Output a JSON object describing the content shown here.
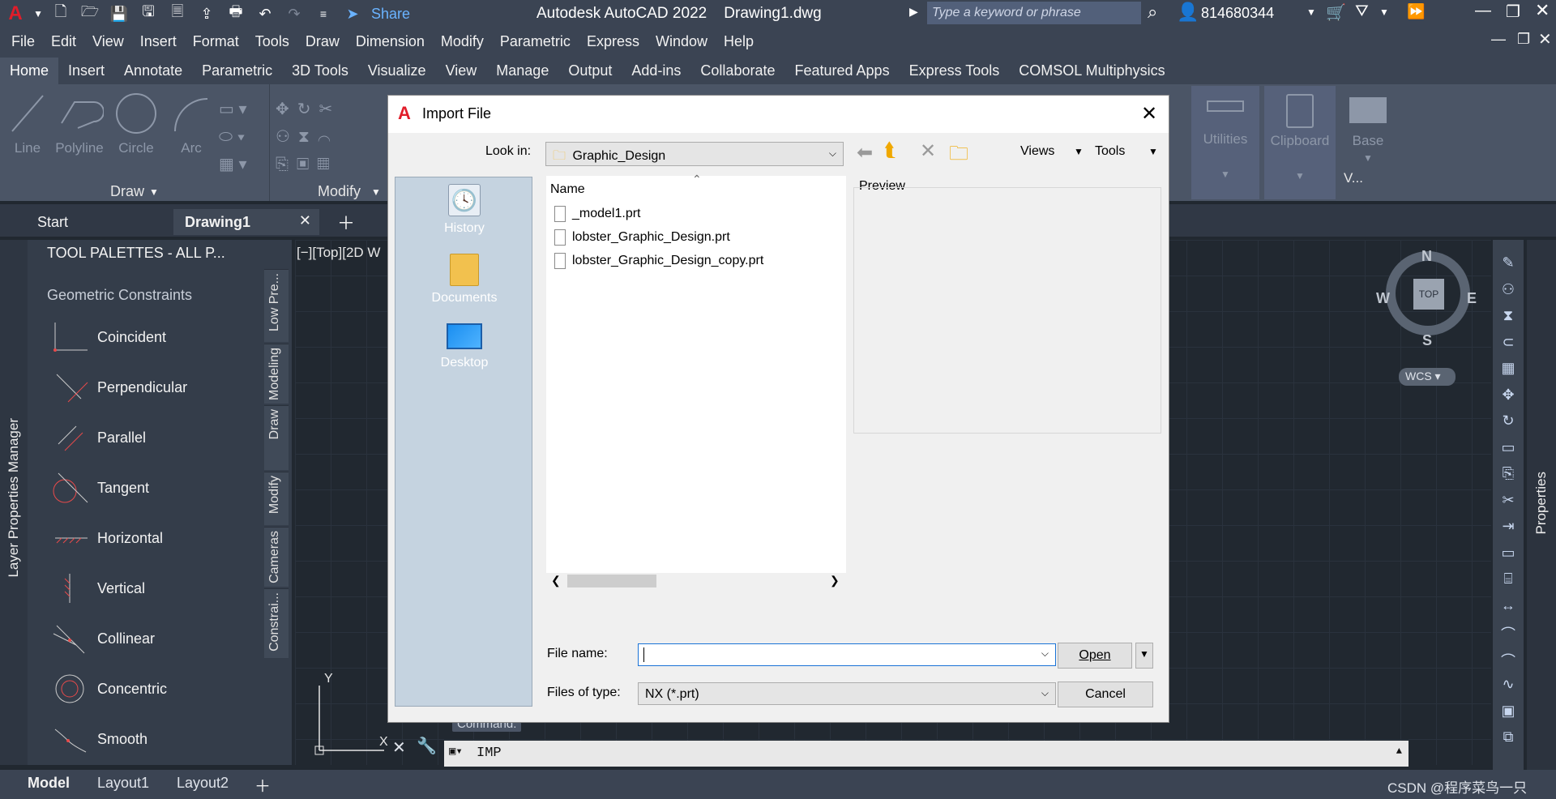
{
  "titlebar": {
    "title": "Autodesk AutoCAD 2022    Drawing1.dwg",
    "share_label": "Share",
    "search_placeholder": "Type a keyword or phrase",
    "user": "814680344"
  },
  "menu": [
    "File",
    "Edit",
    "View",
    "Insert",
    "Format",
    "Tools",
    "Draw",
    "Dimension",
    "Modify",
    "Parametric",
    "Express",
    "Window",
    "Help"
  ],
  "ribbon_tabs": [
    "Home",
    "Insert",
    "Annotate",
    "Parametric",
    "3D Tools",
    "Visualize",
    "View",
    "Manage",
    "Output",
    "Add-ins",
    "Collaborate",
    "Featured Apps",
    "Express Tools",
    "COMSOL Multiphysics"
  ],
  "ribbon": {
    "draw_tools": [
      "Line",
      "Polyline",
      "Circle",
      "Arc"
    ],
    "draw_panel": "Draw",
    "modify_panel": "Modify",
    "utilities": "Utilities",
    "clipboard": "Clipboard",
    "base": "Base",
    "view_short": "V..."
  },
  "doc_tabs": {
    "start": "Start",
    "drawing": "Drawing1"
  },
  "palette": {
    "title": "TOOL PALETTES - ALL P...",
    "side_label": "Layer Properties Manager",
    "section": "Geometric Constraints",
    "tabs": [
      "Low Pre...",
      "Modeling",
      "Draw",
      "Modify",
      "Cameras",
      "Constrai..."
    ],
    "items": [
      "Coincident",
      "Perpendicular",
      "Parallel",
      "Tangent",
      "Horizontal",
      "Vertical",
      "Collinear",
      "Concentric",
      "Smooth"
    ]
  },
  "viewport": {
    "label": "[−][Top][2D W",
    "compass": {
      "n": "N",
      "s": "S",
      "e": "E",
      "w": "W",
      "top": "TOP"
    },
    "wcs": "WCS",
    "properties_label": "Properties"
  },
  "command": {
    "tooltip": "Command:",
    "text": "IMP"
  },
  "status": {
    "tabs": [
      "Model",
      "Layout1",
      "Layout2"
    ],
    "watermark": "CSDN @程序菜鸟一只"
  },
  "dialog": {
    "title": "Import File",
    "look_in_label": "Look in:",
    "look_in_value": "Graphic_Design",
    "views": "Views",
    "tools": "Tools",
    "places": [
      "History",
      "Documents",
      "Desktop"
    ],
    "list_header": "Name",
    "files": [
      "_model1.prt",
      "lobster_Graphic_Design.prt",
      "lobster_Graphic_Design_copy.prt"
    ],
    "preview_label": "Preview",
    "file_name_label": "File name:",
    "file_name_value": "",
    "files_of_type_label": "Files of type:",
    "files_of_type_value": "NX (*.prt)",
    "open_label": "Open",
    "cancel_label": "Cancel"
  },
  "colors": {
    "accent": "#e11d2a",
    "chrome": "#3b4453",
    "dialog_bg": "#f0f0f0"
  }
}
